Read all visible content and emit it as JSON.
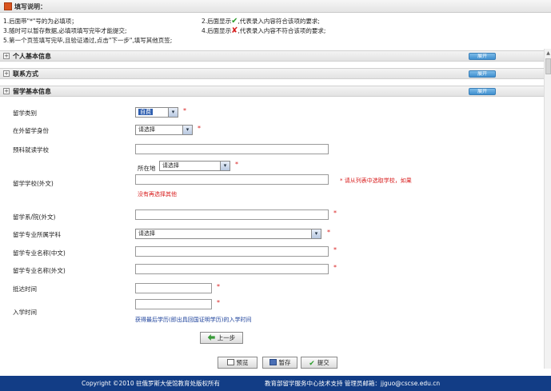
{
  "header": {
    "title": "填写说明："
  },
  "notes": {
    "left": [
      "1.后面带\"*\"号的为必填项；",
      "3.随时可以暂存数据,必填项填写完毕才能提交;",
      "5.第一个页签填写完毕,且验证通过,点击\"下一步\",填写其他页签;"
    ],
    "right": [
      {
        "pre": "2.后面显示",
        "mark": "✔",
        "post": ",代表录入内容符合该项的要求;"
      },
      {
        "pre": "4.后面显示",
        "mark": "✘",
        "post": ",代表录入内容不符合该项的要求;"
      }
    ]
  },
  "sections": [
    {
      "title": "个人基本信息",
      "button": "展开"
    },
    {
      "title": "联系方式",
      "button": "展开"
    },
    {
      "title": "留学基本信息",
      "button": "展开"
    }
  ],
  "form": {
    "study_type": {
      "label": "留学类别",
      "value": "自费"
    },
    "identity": {
      "label": "在外留学身份",
      "value": "请选择"
    },
    "prep_school": {
      "label": "预科就读学校",
      "value": ""
    },
    "school": {
      "label": "留学学校(外文)",
      "location_label": "所在地",
      "location_value": "请选择",
      "value": "",
      "hint1": "* 请从列表中选取学校，如果",
      "hint2": "没有再选择其他"
    },
    "department": {
      "label": "留学系/院(外文)",
      "value": ""
    },
    "discipline": {
      "label": "留学专业所属学科",
      "value": "请选择"
    },
    "major_cn": {
      "label": "留学专业名称(中文)",
      "value": ""
    },
    "major_foreign": {
      "label": "留学专业名称(外文)",
      "value": ""
    },
    "arrival": {
      "label": "抵达时间",
      "value": ""
    },
    "enroll": {
      "label": "入学时间",
      "value": "",
      "hint": "获得最后学历(即出具回国证明学历)的入学时间"
    },
    "star": "*"
  },
  "buttons": {
    "prev": "上一步",
    "preview": "预览",
    "save": "暂存",
    "submit": "提交"
  },
  "footer": {
    "left": "Copyright ©2010 驻俄罗斯大使馆教育处版权所有",
    "right": "教育部留学服务中心技术支持   管理员邮箱：jjguo@cscse.edu.cn"
  },
  "colors": {
    "footer_bg": "#123d86",
    "required": "#d81e1e",
    "hint_blue": "#1a3f9a",
    "check": "#2d9d2d",
    "cross": "#d61f1f"
  }
}
